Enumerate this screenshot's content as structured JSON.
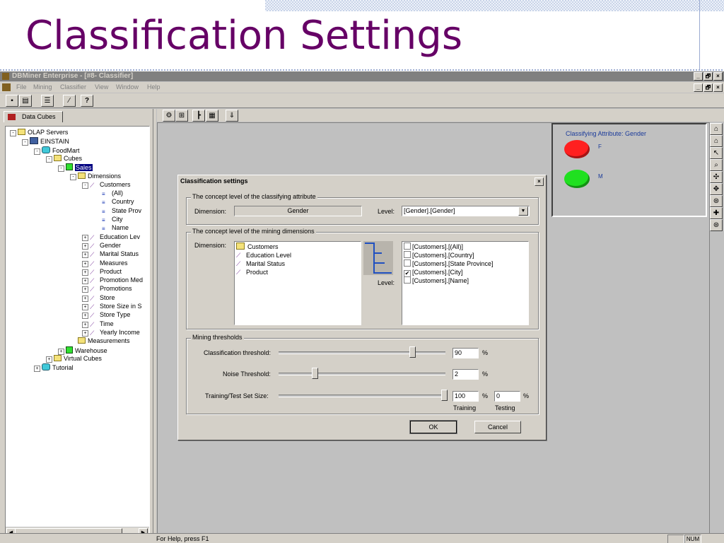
{
  "slide": {
    "title": "Classification Settings"
  },
  "window": {
    "title": "DBMiner Enterprise - [#8- Classifier]",
    "controls": {
      "minimize": "_",
      "restore": "🗗",
      "close": "×"
    }
  },
  "menu": [
    "File",
    "Mining",
    "Classifier",
    "View",
    "Window",
    "Help"
  ],
  "toolbar": {
    "help_label": "?"
  },
  "left_panel": {
    "tab_label": "Data Cubes",
    "tree": [
      {
        "label": "OLAP Servers",
        "icon": "folder-icon",
        "level": 0,
        "expander": "-"
      },
      {
        "label": "EINSTAIN",
        "icon": "server-icon",
        "level": 1,
        "expander": "-"
      },
      {
        "label": "FoodMart",
        "icon": "database-icon",
        "level": 2,
        "expander": "-"
      },
      {
        "label": "Cubes",
        "icon": "folder-icon",
        "level": 3,
        "expander": "-"
      },
      {
        "label": "Sales",
        "icon": "cube-icon",
        "level": 4,
        "expander": "-",
        "selected": true
      },
      {
        "label": "Dimensions",
        "icon": "folder-icon",
        "level": 5,
        "expander": "-"
      },
      {
        "label": "Customers",
        "icon": "dimension-icon",
        "level": 6,
        "expander": "-"
      },
      {
        "label": "(All)",
        "icon": "level-icon",
        "level": 7
      },
      {
        "label": "Country",
        "icon": "level-icon",
        "level": 7
      },
      {
        "label": "State Prov",
        "icon": "level-icon",
        "level": 7
      },
      {
        "label": "City",
        "icon": "level-icon",
        "level": 7
      },
      {
        "label": "Name",
        "icon": "level-icon",
        "level": 7
      },
      {
        "label": "Education Lev",
        "icon": "dimension-icon",
        "level": 6,
        "expander": "+"
      },
      {
        "label": "Gender",
        "icon": "dimension-icon",
        "level": 6,
        "expander": "+"
      },
      {
        "label": "Marital Status",
        "icon": "dimension-icon",
        "level": 6,
        "expander": "+"
      },
      {
        "label": "Measures",
        "icon": "dimension-icon",
        "level": 6,
        "expander": "+"
      },
      {
        "label": "Product",
        "icon": "dimension-icon",
        "level": 6,
        "expander": "+"
      },
      {
        "label": "Promotion Med",
        "icon": "dimension-icon",
        "level": 6,
        "expander": "+"
      },
      {
        "label": "Promotions",
        "icon": "dimension-icon",
        "level": 6,
        "expander": "+"
      },
      {
        "label": "Store",
        "icon": "dimension-icon",
        "level": 6,
        "expander": "+"
      },
      {
        "label": "Store Size in S",
        "icon": "dimension-icon",
        "level": 6,
        "expander": "+"
      },
      {
        "label": "Store Type",
        "icon": "dimension-icon",
        "level": 6,
        "expander": "+"
      },
      {
        "label": "Time",
        "icon": "dimension-icon",
        "level": 6,
        "expander": "+"
      },
      {
        "label": "Yearly Income",
        "icon": "dimension-icon",
        "level": 6,
        "expander": "+"
      },
      {
        "label": "Measurements",
        "icon": "folder-icon",
        "level": 5
      },
      {
        "label": "Warehouse",
        "icon": "cube-icon",
        "level": 4,
        "expander": "+"
      },
      {
        "label": "Virtual Cubes",
        "icon": "folder-icon",
        "level": 3,
        "expander": "+"
      },
      {
        "label": "Tutorial",
        "icon": "database-icon",
        "level": 2,
        "expander": "+"
      }
    ]
  },
  "legend_box": {
    "title": "Classifying Attribute: Gender",
    "items": [
      {
        "label": "F",
        "color": "#ff2020"
      },
      {
        "label": "M",
        "color": "#20e020"
      }
    ]
  },
  "dialog": {
    "title": "Classification settings",
    "close_label": "×",
    "concept_group": {
      "legend": "The concept level of the classifying attribute",
      "dimension_label": "Dimension:",
      "dimension_value": "Gender",
      "level_label": "Level:",
      "level_value": "[Gender].[Gender]"
    },
    "mining_group": {
      "legend": "The concept level of the mining dimensions",
      "dimension_label": "Dimension:",
      "dimensions": [
        "Customers",
        "Education Level",
        "Marital Status",
        "Product"
      ],
      "level_label": "Level:",
      "levels": [
        {
          "label": "[Customers].[(All)]",
          "checked": false
        },
        {
          "label": "[Customers].[Country]",
          "checked": false
        },
        {
          "label": "[Customers].[State Province]",
          "checked": false
        },
        {
          "label": "[Customers].[City]",
          "checked": true
        },
        {
          "label": "[Customers].[Name]",
          "checked": false
        }
      ]
    },
    "thresholds": {
      "legend": "Mining thresholds",
      "classification": {
        "label": "Classification threshold:",
        "value": "90",
        "unit": "%"
      },
      "noise": {
        "label": "Noise Threshold:",
        "value": "2",
        "unit": "%"
      },
      "training": {
        "label": "Training/Test Set Size:",
        "training_value": "100",
        "testing_value": "0",
        "unit": "%",
        "training_caption": "Training",
        "testing_caption": "Testing"
      }
    },
    "ok_label": "OK",
    "cancel_label": "Cancel"
  },
  "status_bar": {
    "text": "For Help, press F1",
    "num": "NUM"
  }
}
